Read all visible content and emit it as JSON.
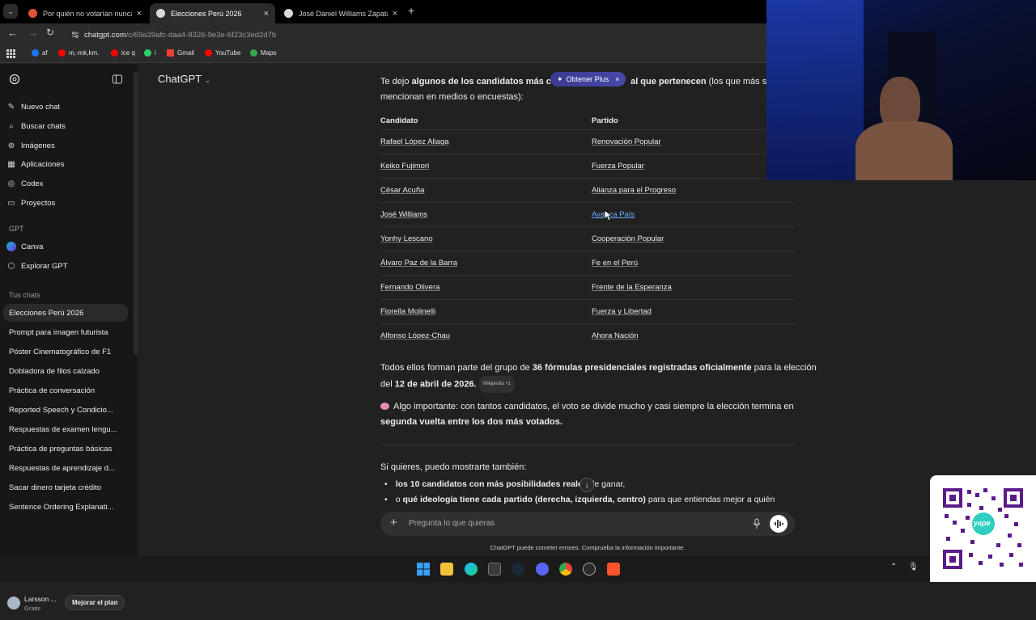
{
  "browser": {
    "tabs": [
      {
        "title": "Por quién no votarían nunca y p",
        "active": false
      },
      {
        "title": "Elecciones Perú 2026",
        "active": true
      },
      {
        "title": "José Daniel Williams Zapata - B",
        "active": false
      }
    ],
    "url_host": "chatgpt.com",
    "url_path": "/c/69a39afc-daa4-8326-9e3e-6f23c3ed2d7b",
    "bookmarks": [
      "af",
      "m,-mk,km.",
      "ice q",
      "i",
      "Gmail",
      "YouTube",
      "Maps"
    ]
  },
  "sidebar": {
    "nav": [
      {
        "label": "Nuevo chat",
        "icon": "edit-icon"
      },
      {
        "label": "Buscar chats",
        "icon": "search-icon"
      },
      {
        "label": "Imágenes",
        "icon": "image-icon"
      },
      {
        "label": "Aplicaciones",
        "icon": "apps-icon"
      },
      {
        "label": "Codex",
        "icon": "codex-icon"
      },
      {
        "label": "Proyectos",
        "icon": "folder-icon"
      }
    ],
    "gpt_label": "GPT",
    "gpts": [
      {
        "label": "Canva",
        "icon": "canva-icon"
      },
      {
        "label": "Explorar GPT",
        "icon": "explore-icon"
      }
    ],
    "chats_label": "Tus chats",
    "chats": [
      "Elecciones Perú 2026",
      "Prompt para imagen futurista",
      "Póster Cinematográfico de F1",
      "Dobladora de filos calzado",
      "Práctica de conversación",
      "Reported Speech y Condicio...",
      "Respuestas de examen lengu...",
      "Práctica de preguntas básicas",
      "Respuestas de aprendizaje d...",
      "Sacar dinero tarjeta crédito",
      "Sentence Ordering Explanati..."
    ],
    "profile": {
      "name": "Larsson ...",
      "plan": "Gratis",
      "upgrade_label": "Mejorar el plan"
    }
  },
  "main": {
    "model": "ChatGPT",
    "obtener_plus": "Obtener Plus",
    "intro": {
      "a": "Te dejo ",
      "b": "algunos de los candidatos más cono",
      "c": "al que pertenecen",
      "d": " (los que más se",
      "line2": "mencionan en medios o encuestas):"
    },
    "table": {
      "headers": [
        "Candidato",
        "Partido"
      ],
      "rows": [
        [
          "Rafael López Aliaga",
          "Renovación Popular"
        ],
        [
          "Keiko Fujimori",
          "Fuerza Popular"
        ],
        [
          "César Acuña",
          "Alianza para el Progreso"
        ],
        [
          "José Williams",
          "Avanza País"
        ],
        [
          "Yonhy Lescano",
          "Cooperación Popular"
        ],
        [
          "Álvaro Paz de la Barra",
          "Fe en el Perú"
        ],
        [
          "Fernando Olivera",
          "Frente de la Esperanza"
        ],
        [
          "Fiorella Molinelli",
          "Fuerza y Libertad"
        ],
        [
          "Alfonso López-Chau",
          "Ahora Nación"
        ]
      ]
    },
    "summary": {
      "a": "Todos ellos forman parte del grupo de ",
      "b": "36 fórmulas presidenciales registradas oficialmente",
      "c": " para la elección",
      "d": "del ",
      "e": "12 de abril de 2026.",
      "source": "Wikipedia",
      "source_more": "+1"
    },
    "important": {
      "a": "Algo importante: con tantos candidatos, el voto se divide mucho y casi siempre la elección termina en",
      "b": "segunda vuelta entre los dos más votados."
    },
    "offer": "Si quieres, puedo mostrarte también:",
    "bullets": [
      {
        "bold": "los 10 candidatos con más posibilidades reales",
        "rest": " de ganar,"
      },
      {
        "bold": "qué ideología tiene cada partido (derecha, izquierda, centro)",
        "rest": " para que entiendas mejor a quién",
        "prefix": "o "
      }
    ],
    "composer_placeholder": "Pregunta lo que quieras",
    "disclaimer": "ChatGPT puede cometer errores. Comprueba la información importante."
  },
  "qr": {
    "brand": "yape"
  }
}
